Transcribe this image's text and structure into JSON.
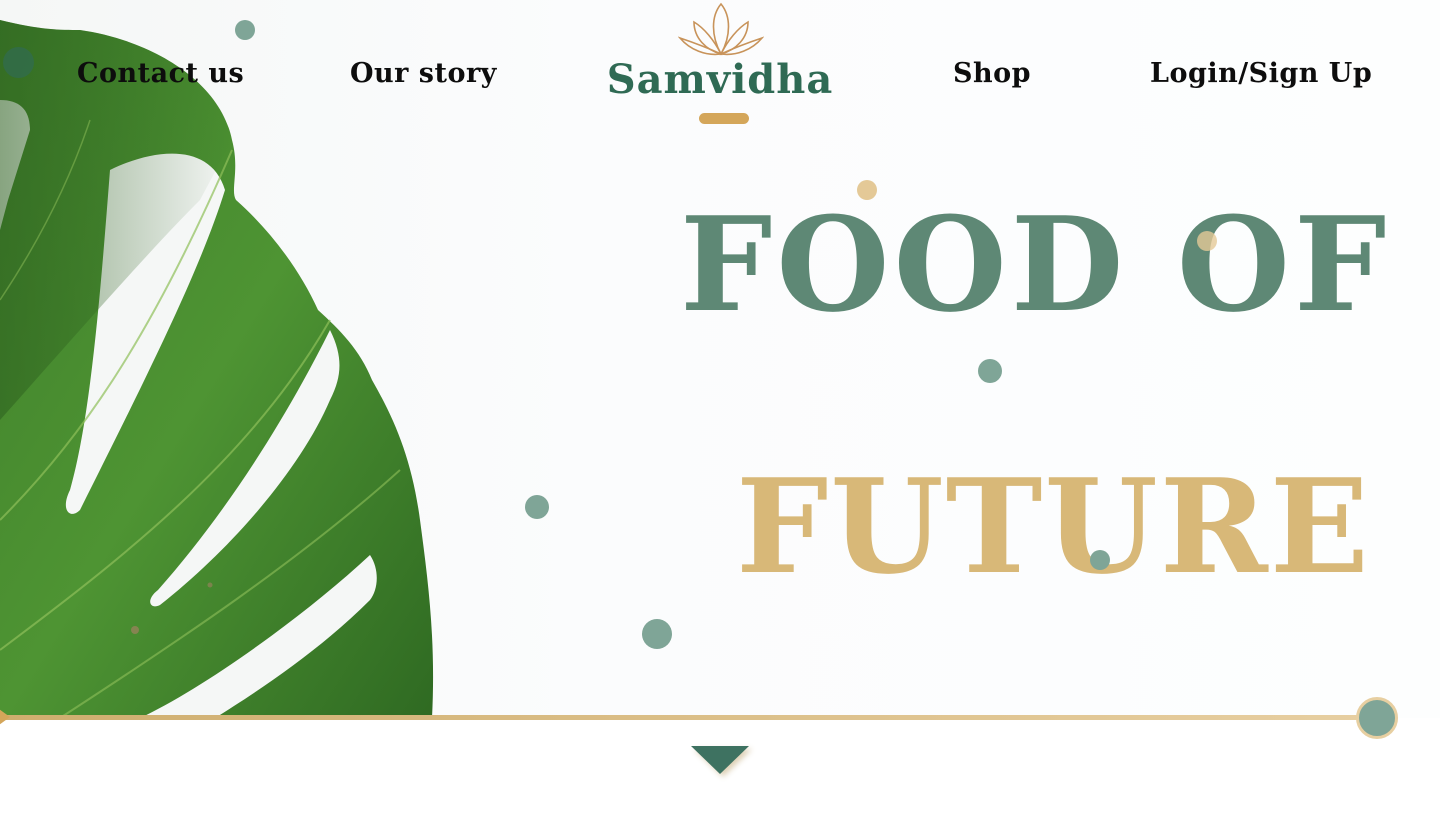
{
  "nav": {
    "contact_label": "Contact us",
    "story_label": "Our story",
    "shop_label": "Shop",
    "login_label": "Login/Sign Up"
  },
  "logo": {
    "text": "Samvidha",
    "icon": "lotus-icon"
  },
  "hero": {
    "headline_line1": "FOOD OF",
    "headline_line2": "FUTURE"
  },
  "icons": {
    "scroll_down": "triangle-down-icon",
    "divider_end": "circle-icon"
  },
  "colors": {
    "brand_green": "#2f6a54",
    "headline_green": "#5e8875",
    "headline_gold": "#d8b878",
    "accent_gold": "#d4a65a",
    "dot_green": "#7fa597"
  }
}
